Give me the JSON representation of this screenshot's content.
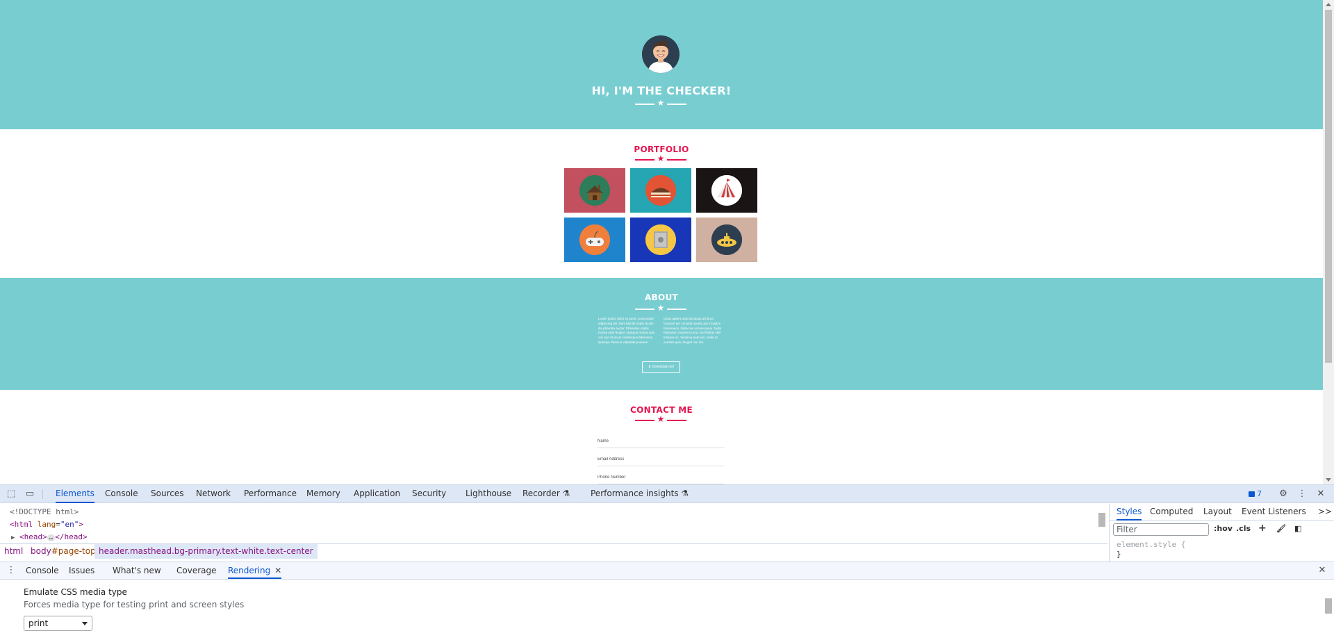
{
  "masthead": {
    "title": "HI, I'M THE CHECKER!"
  },
  "portfolio": {
    "title": "PORTFOLIO",
    "items": [
      {
        "name": "cabin",
        "bg": "#c2505f",
        "icon_bg": "#2e7d5a"
      },
      {
        "name": "cake",
        "bg": "#26a5b2",
        "icon_bg": "#e35336"
      },
      {
        "name": "circus-tent",
        "bg": "#1b1414",
        "icon_bg": "#ffffff"
      },
      {
        "name": "game-controller",
        "bg": "#1f84cc",
        "icon_bg": "#f07f3c"
      },
      {
        "name": "safe",
        "bg": "#1836b8",
        "icon_bg": "#f5c745"
      },
      {
        "name": "submarine",
        "bg": "#d0b0a0",
        "icon_bg": "#2c3e50"
      }
    ]
  },
  "about": {
    "title": "ABOUT",
    "left_text": "Lorem ipsum dolor sit amet, consectetur adipiscing elit. Nam blandit turpis iaculis dui pharetra auctor. Phasellus mattis massa ante feugiat. Quisque massa quis orci non rhoncus scelerisque bibendum. Quisque rhoncus vulputate posuere.",
    "right_text": "Class aptent taciti sociosqu ad litora torquent per conubia nostra, per inceptos himenaeos. Nulla non ornare purus. Nulla bibendum maximus urna, sed finibus velit tristique ac. Vivamus ante est, mollis at sodales quis, feugiat non dui.",
    "button_label": "Download me!"
  },
  "contact": {
    "title": "CONTACT ME",
    "fields": {
      "name": "Name",
      "email": "Email Address",
      "phone": "Phone Number"
    }
  },
  "devtools": {
    "tabs": [
      "Elements",
      "Console",
      "Sources",
      "Network",
      "Performance",
      "Memory",
      "Application",
      "Security",
      "Lighthouse",
      "Recorder",
      "Performance insights"
    ],
    "active_tab": "Elements",
    "issues_count": "7",
    "dom": {
      "doctype": "<!DOCTYPE html>",
      "html_open": "<html",
      "html_attr": "lang",
      "html_val": "\"en\"",
      "html_close": ">",
      "head_open": "<head>",
      "head_ellipsis": "…",
      "head_close": "</head>"
    },
    "styles": {
      "tabs": [
        "Styles",
        "Computed",
        "Layout",
        "Event Listeners"
      ],
      "more": ">>",
      "filter_placeholder": "Filter",
      "hov": ":hov",
      "cls": ".cls",
      "element_style_open": "element.style {",
      "element_style_close": "}"
    },
    "breadcrumb": {
      "html": "html",
      "body": "body",
      "body_id": "#page-top",
      "header": "header.masthead.bg-primary.text-white.text-center"
    },
    "drawer": {
      "tabs": [
        "Console",
        "Issues",
        "What's new",
        "Coverage",
        "Rendering"
      ],
      "active_tab": "Rendering"
    },
    "rendering": {
      "title": "Emulate CSS media type",
      "subtitle": "Forces media type for testing print and screen styles",
      "select_value": "print"
    }
  }
}
